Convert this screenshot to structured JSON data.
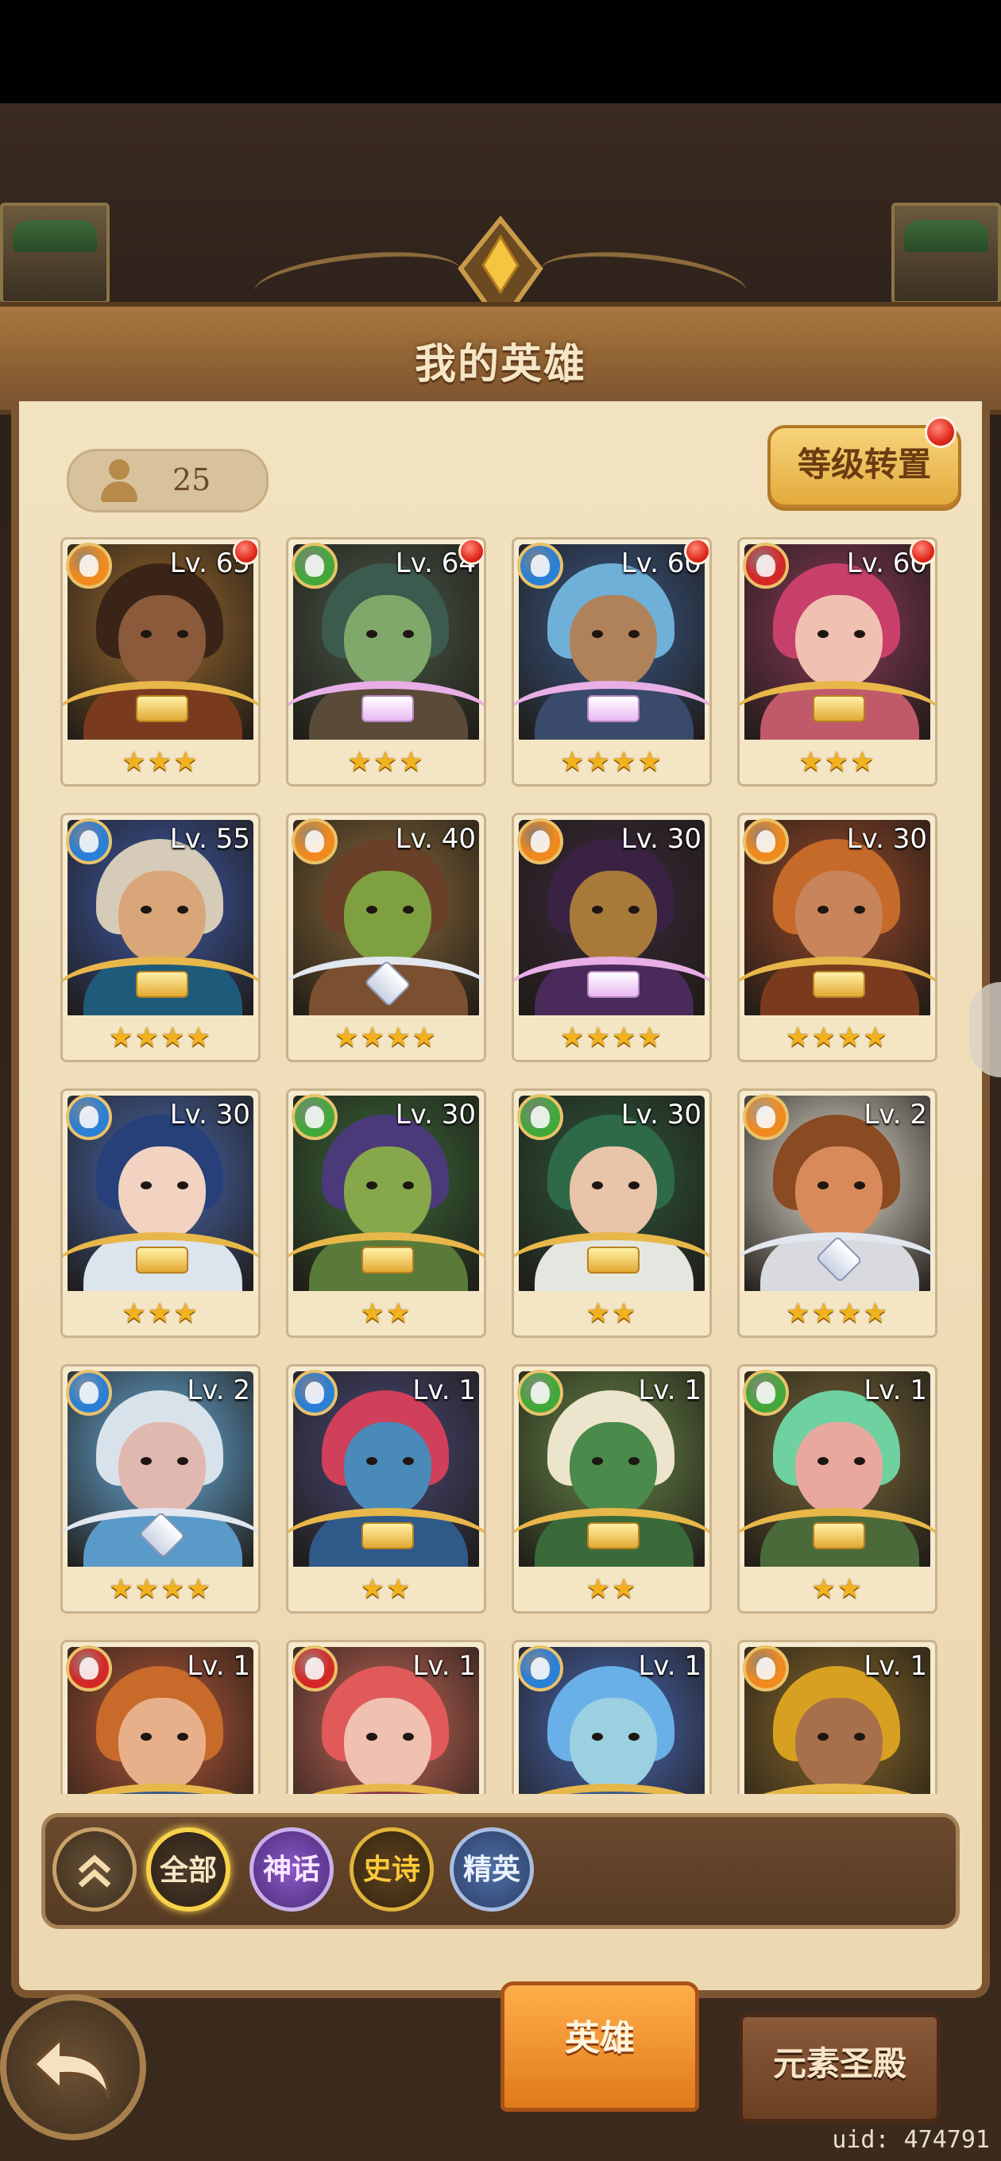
{
  "screen": {
    "title": "我的英雄"
  },
  "hero_count": "25",
  "level_transfer_label": "等级转置",
  "colors": {
    "fire": "#f08a1e",
    "wind": "#43a83a",
    "water": "#2a7fd6",
    "blood": "#d42828",
    "banner": "#8c6033",
    "panel": "#f2e2c0"
  },
  "heroes": [
    {
      "level": "Lv. 65",
      "element": "fire",
      "stars": "★★★",
      "rarity": "epic",
      "notify": true,
      "skin": "#8a5a3a",
      "hair": "#3a2418",
      "bg": "#9a6a2e",
      "outfit": "#7a3a1e"
    },
    {
      "level": "Lv. 64",
      "element": "wind",
      "stars": "★★★",
      "rarity": "mythic",
      "notify": true,
      "skin": "#7fa86a",
      "hair": "#3c5a4e",
      "bg": "#4a5a4a",
      "outfit": "#5a4a38"
    },
    {
      "level": "Lv. 60",
      "element": "water",
      "stars": "★★★★",
      "rarity": "mythic",
      "notify": true,
      "skin": "#b0825a",
      "hair": "#6fb0d8",
      "bg": "#3a5a8a",
      "outfit": "#3a4a6a"
    },
    {
      "level": "Lv. 60",
      "element": "blood",
      "stars": "★★★",
      "rarity": "epic",
      "notify": true,
      "skin": "#f0c0b0",
      "hair": "#c8406a",
      "bg": "#8a3a5a",
      "outfit": "#c05a6a"
    },
    {
      "level": "Lv. 55",
      "element": "water",
      "stars": "★★★★",
      "rarity": "epic",
      "notify": false,
      "skin": "#d9a67a",
      "hair": "#d6cbb8",
      "bg": "#3e5aa8",
      "outfit": "#1e5a7a"
    },
    {
      "level": "Lv. 40",
      "element": "fire",
      "stars": "★★★★",
      "rarity": "elite",
      "notify": false,
      "skin": "#7ea040",
      "hair": "#6a4028",
      "bg": "#8a6a3a",
      "outfit": "#7a5030"
    },
    {
      "level": "Lv. 30",
      "element": "fire",
      "stars": "★★★★",
      "rarity": "mythic",
      "notify": false,
      "skin": "#a87a3a",
      "hair": "#3a2244",
      "bg": "#3a2a3a",
      "outfit": "#4a2a5a"
    },
    {
      "level": "Lv. 30",
      "element": "fire",
      "stars": "★★★★",
      "rarity": "epic",
      "notify": false,
      "skin": "#c8845a",
      "hair": "#c66a2a",
      "bg": "#9a4a2a",
      "outfit": "#7a3a1e"
    },
    {
      "level": "Lv. 30",
      "element": "water",
      "stars": "★★★",
      "rarity": "epic",
      "notify": false,
      "skin": "#f2d2c0",
      "hair": "#27407a",
      "bg": "#4a6ab0",
      "outfit": "#dce4ee"
    },
    {
      "level": "Lv. 30",
      "element": "wind",
      "stars": "★★",
      "rarity": "epic",
      "notify": false,
      "skin": "#86a84a",
      "hair": "#4a3a7a",
      "bg": "#3a6a3a",
      "outfit": "#5a7a3a"
    },
    {
      "level": "Lv. 30",
      "element": "wind",
      "stars": "★★",
      "rarity": "epic",
      "notify": false,
      "skin": "#e8c4a8",
      "hair": "#2f6a48",
      "bg": "#2f5a3e",
      "outfit": "#e6e6e0"
    },
    {
      "level": "Lv. 2",
      "element": "fire",
      "stars": "★★★★",
      "rarity": "elite",
      "notify": false,
      "skin": "#d88a5a",
      "hair": "#8a4a22",
      "bg": "#e8e2d4",
      "outfit": "#d8dae0"
    },
    {
      "level": "Lv. 2",
      "element": "water",
      "stars": "★★★★",
      "rarity": "elite",
      "notify": false,
      "skin": "#e0b8b0",
      "hair": "#d8e2ea",
      "bg": "#6ab0e0",
      "outfit": "#5a9ac8"
    },
    {
      "level": "Lv. 1",
      "element": "water",
      "stars": "★★",
      "rarity": "epic",
      "notify": false,
      "skin": "#4a8ab8",
      "hair": "#d0405a",
      "bg": "#4a4a7a",
      "outfit": "#2e5a8a"
    },
    {
      "level": "Lv. 1",
      "element": "wind",
      "stars": "★★",
      "rarity": "epic",
      "notify": false,
      "skin": "#4a8a4a",
      "hair": "#ece4cc",
      "bg": "#6a8a4a",
      "outfit": "#3a6a3a"
    },
    {
      "level": "Lv. 1",
      "element": "wind",
      "stars": "★★",
      "rarity": "epic",
      "notify": false,
      "skin": "#e8a8a0",
      "hair": "#6fd0a0",
      "bg": "#7a6a3a",
      "outfit": "#4a6a3a"
    },
    {
      "level": "Lv. 1",
      "element": "blood",
      "stars": "",
      "rarity": "epic",
      "notify": false,
      "skin": "#e8b08a",
      "hair": "#c86a2a",
      "bg": "#b85a3a",
      "outfit": "#3a5a8a"
    },
    {
      "level": "Lv. 1",
      "element": "blood",
      "stars": "",
      "rarity": "epic",
      "notify": false,
      "skin": "#f0c0b0",
      "hair": "#e05a5a",
      "bg": "#c86a5a",
      "outfit": "#8a3a4a"
    },
    {
      "level": "Lv. 1",
      "element": "water",
      "stars": "",
      "rarity": "epic",
      "notify": false,
      "skin": "#9ad0e0",
      "hair": "#6ab0e8",
      "bg": "#4a6ab8",
      "outfit": "#3a5a8a"
    },
    {
      "level": "Lv. 1",
      "element": "fire",
      "stars": "",
      "rarity": "epic",
      "notify": false,
      "skin": "#a8704a",
      "hair": "#d8a020",
      "bg": "#8a6a2a",
      "outfit": "#e0b030"
    }
  ],
  "filters": {
    "collapse_icon": "double-chevron-up-icon",
    "all": "全部",
    "mythic": "神话",
    "epic": "史诗",
    "elite": "精英"
  },
  "tabs": {
    "heroes": "英雄",
    "temple": "元素圣殿"
  },
  "uid": "uid: 474791"
}
